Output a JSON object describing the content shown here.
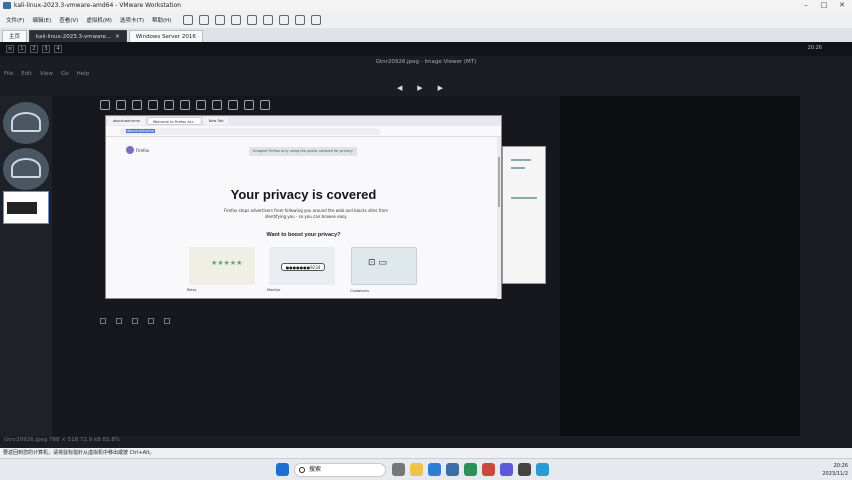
{
  "vmware": {
    "title": "kali-linux-2023.3-vmware-amd64 - VMware Workstation",
    "menu": [
      "文件(F)",
      "编辑(E)",
      "查看(V)",
      "虚拟机(M)",
      "选项卡(T)",
      "帮助(H)"
    ],
    "tabs": [
      "主页",
      "kali-linux-2023.3-vmware...",
      "Windows Server 2016"
    ],
    "hint": "要返回到您的计算机，请将鼠标指针从虚拟机中移出或按 Ctrl+Alt。"
  },
  "kali_topbar": {
    "workspaces": [
      "1",
      "2",
      "3",
      "4"
    ],
    "clock": "20:26"
  },
  "image_viewer": {
    "title": "Gtnr20926.jpeg - Image Viewer (MT)",
    "menu": [
      "File",
      "Edit",
      "View",
      "Go",
      "Help"
    ],
    "nav": {
      "prev": "◀",
      "play": "▶",
      "next": "▶"
    },
    "status": "Gtnr20926.jpeg    768 × 518    72.9 kB    82.8%"
  },
  "firefox": {
    "tabs": [
      "about:welcome",
      "Welcome to Firefox Acc..",
      "New Tab"
    ],
    "url": "about:welcome",
    "brand": "Firefox",
    "notice": "Imagine Firefox only using the public network for privacy",
    "heading": "Your privacy is covered",
    "subtext": "Firefox stops advertisers from following you around the web and blocks sites from identifying you - so you can browse easy.",
    "boost": "Want to boost your privacy?",
    "cards": [
      {
        "label": "Relay",
        "art": "★★★★★"
      },
      {
        "label": "Monitor",
        "art": "●●●●●●●9234"
      },
      {
        "label": "Containers",
        "art": "⊡ ▭"
      }
    ]
  },
  "taskbar": {
    "search_placeholder": "搜索",
    "time": "20:26",
    "date": "2023/11/2"
  }
}
